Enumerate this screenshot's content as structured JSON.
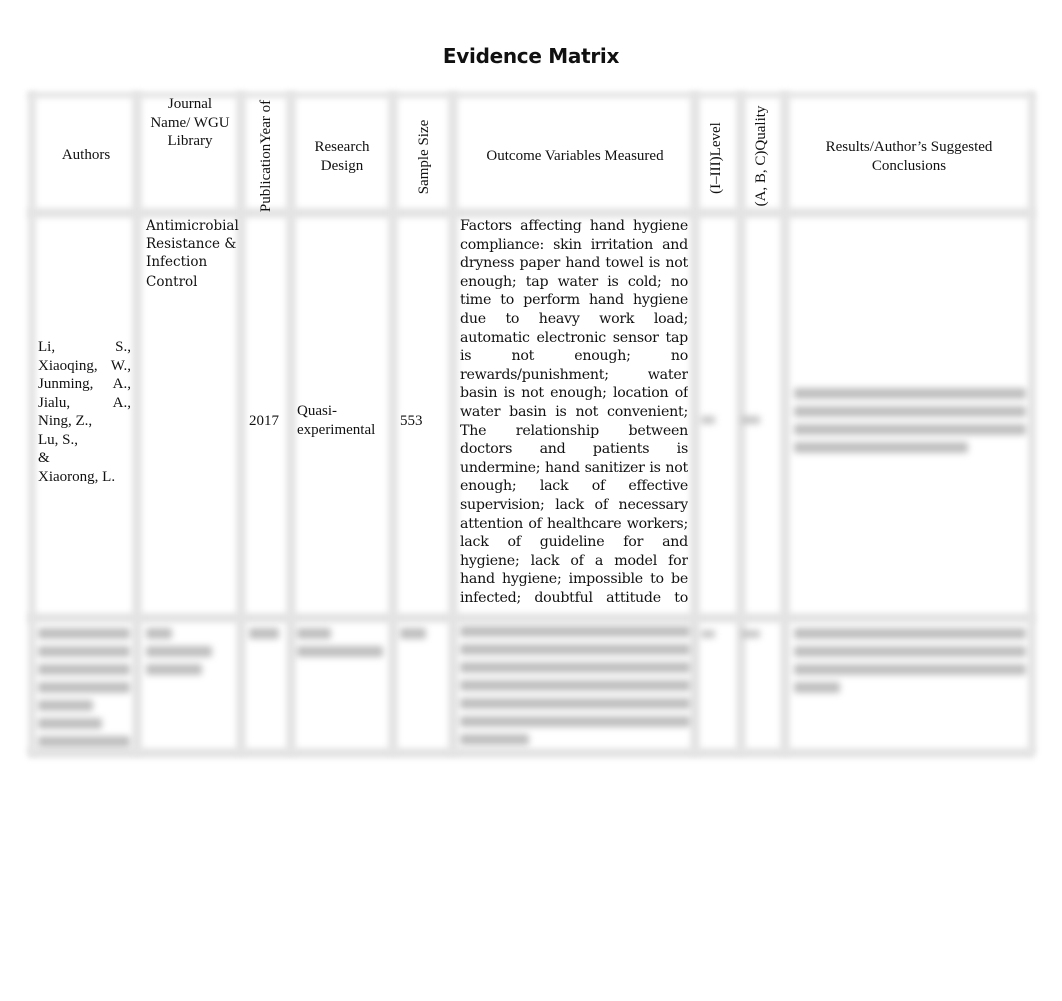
{
  "document": {
    "title": "Evidence Matrix"
  },
  "table": {
    "headers": {
      "authors": "Authors",
      "journal": "Journal Name/ WGU Library",
      "journal_lines": [
        "Journal",
        "Name/ WGU",
        "Library"
      ],
      "year": "PublicationYear of",
      "design_lines": [
        "Research",
        "Design"
      ],
      "sample": "Sample Size",
      "outcome": "Outcome Variables Measured",
      "level": "(I–III)Level",
      "quality": "(A, B, C)Quality",
      "results_lines": [
        "Results/Author’s Suggested",
        "Conclusions"
      ]
    },
    "rows": [
      {
        "authors_lines": [
          "Li, S.,",
          "Xiaoqing, W.,",
          "Junming, A.,",
          "Jialu, A.,",
          "Ning, Z.,",
          "Lu, S.,",
          "&",
          "Xiaorong, L."
        ],
        "journal_lines": [
          "Antimicrobial",
          "Resistance &",
          "Infection",
          "Control"
        ],
        "year": "2017",
        "design_lines": [
          "Quasi-",
          "experimental"
        ],
        "sample": "553",
        "outcome": "Factors affecting hand hygiene compliance: skin irritation and dryness paper hand towel is not enough; tap water is cold; no time to perform hand hygiene due to heavy work load; automatic electronic sensor tap is not enough; no rewards/punishment; water basin is not enough; location of water basin is not convenient; The relationship between doctors and patients is undermine; hand sanitizer is not enough; lack of effective supervision; lack of necessary attention of healthcare workers; lack of guideline for and hygiene; lack of a model for hand hygiene; impossible to be infected; doubtful attitude to hand hygiene; disapproval of hand hygiene rules; forgetting about the indication of",
        "level": "",
        "quality": "",
        "results": "",
        "results_obscured": true
      },
      {
        "obscured": true
      }
    ]
  }
}
